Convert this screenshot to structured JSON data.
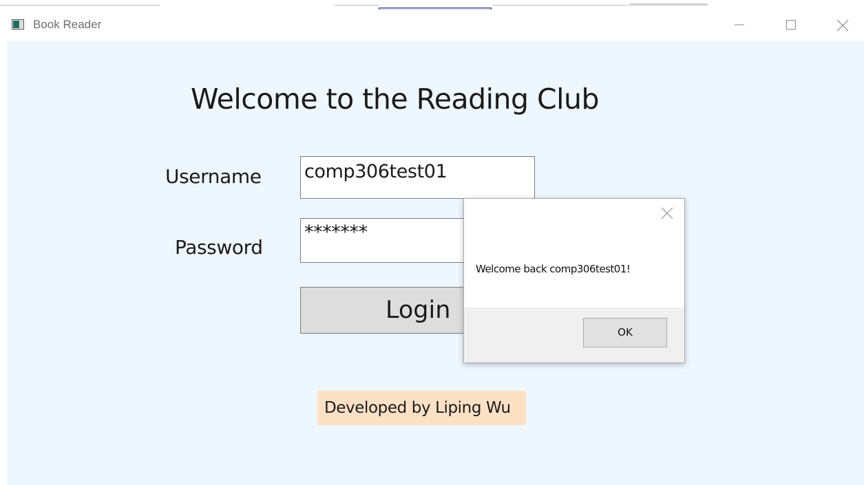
{
  "window": {
    "title": "Book Reader",
    "minimize_label": "—",
    "maximize_label": "☐",
    "close_label": "✕"
  },
  "login_form": {
    "heading": "Welcome to the Reading Club",
    "username_label": "Username",
    "username_value": "comp306test01",
    "password_label": "Password",
    "password_value": "*******",
    "login_label": "Login",
    "credit": "Developed by Liping Wu"
  },
  "message_box": {
    "message": "Welcome back comp306test01!",
    "ok_label": "OK"
  },
  "icons": {
    "app": "book-reader-app-icon",
    "minimize": "minimize-icon",
    "maximize": "maximize-icon",
    "close": "close-icon",
    "drag": "drag-handle-grip-icon"
  },
  "colors": {
    "client_background": "#eef6fe",
    "credit_background": "#fde1c5",
    "login_button": "#dddddd",
    "dialog_footer": "#f0f0f0"
  }
}
